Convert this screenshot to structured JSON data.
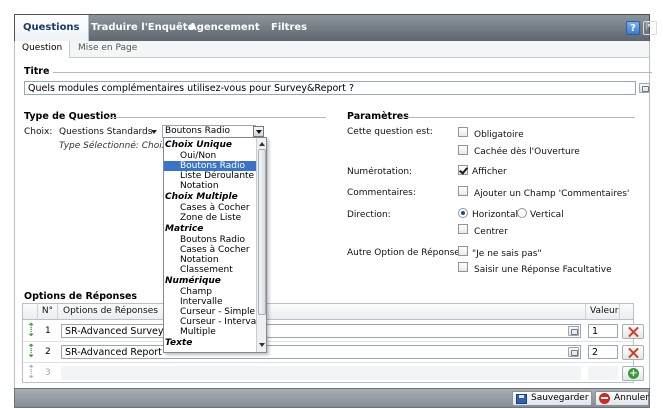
{
  "top_tabs": [
    "Questions",
    "Traduire l'Enquête",
    "Agencement",
    "Filtres"
  ],
  "header_buttons": {
    "help": "?"
  },
  "sub_tabs": [
    "Question",
    "Mise en Page"
  ],
  "titre": {
    "heading": "Titre",
    "value": "Quels modules complémentaires utilisez-vous pour Survey&Report ?"
  },
  "type_question": {
    "heading": "Type de Question",
    "choix_label": "Choix:",
    "category_value": "Questions Standards",
    "type_value": "Boutons Radio",
    "selected_text": "Type Sélectionné: Choix U"
  },
  "dropdown": {
    "groups": [
      {
        "label": "Choix Unique",
        "items": [
          "Oui/Non",
          "Boutons Radio",
          "Liste Déroulante",
          "Notation"
        ]
      },
      {
        "label": "Choix Multiple",
        "items": [
          "Cases à Cocher",
          "Zone de Liste"
        ]
      },
      {
        "label": "Matrice",
        "items": [
          "Boutons Radio",
          "Cases à Cocher",
          "Notation",
          "Classement"
        ]
      },
      {
        "label": "Numérique",
        "items": [
          "Champ",
          "Intervalle",
          "Curseur - Simple",
          "Curseur - Intervalle",
          "Multiple"
        ]
      },
      {
        "label": "Texte",
        "items": []
      }
    ],
    "selected": "Boutons Radio"
  },
  "parametres": {
    "heading": "Paramètres",
    "question_est_label": "Cette question est:",
    "obligatoire": {
      "label": "Obligatoire",
      "checked": false
    },
    "cachee": {
      "label": "Cachée dès l'Ouverture",
      "checked": false
    },
    "numerotation_label": "Numérotation:",
    "afficher": {
      "label": "Afficher",
      "checked": true
    },
    "commentaires_label": "Commentaires:",
    "ajouter_champ": {
      "label": "Ajouter un Champ 'Commentaires'",
      "checked": false
    },
    "direction_label": "Direction:",
    "horizontal": {
      "label": "Horizontal",
      "checked": true
    },
    "vertical": {
      "label": "Vertical",
      "checked": false
    },
    "centrer": {
      "label": "Centrer",
      "checked": false
    },
    "autre_option_label": "Autre Option de Réponse",
    "je_ne_sais_pas": {
      "label": "\"Je ne sais pas\"",
      "checked": false
    },
    "reponse_facultative": {
      "label": "Saisir une Réponse Facultative",
      "checked": false
    }
  },
  "options_reponses": {
    "heading": "Options de Réponses",
    "columns": {
      "num": "N°",
      "options": "Options de Réponses",
      "valeur": "Valeur"
    },
    "rows": [
      {
        "num": "1",
        "text": "SR-Advanced Survey",
        "value": "1"
      },
      {
        "num": "2",
        "text": "SR-Advanced Report",
        "value": "2"
      },
      {
        "num": "3",
        "text": "",
        "value": ""
      }
    ]
  },
  "footer": {
    "save": "Sauvegarder",
    "cancel": "Annuler"
  },
  "colors": {
    "accent": "#3a73c8",
    "tab_bar": "#6f777e",
    "delete": "#d63a1f",
    "add": "#3a9a3a"
  }
}
